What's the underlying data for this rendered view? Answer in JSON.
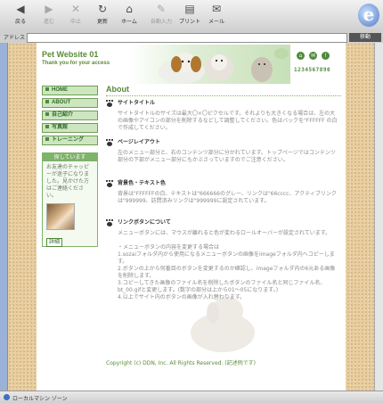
{
  "browser": {
    "toolbar": [
      {
        "label": "戻る",
        "icon": "back-icon",
        "enabled": true
      },
      {
        "label": "進む",
        "icon": "forward-icon",
        "enabled": false
      },
      {
        "label": "中止",
        "icon": "stop-icon",
        "enabled": false
      },
      {
        "label": "更新",
        "icon": "refresh-icon",
        "enabled": true
      },
      {
        "label": "ホーム",
        "icon": "home-icon",
        "enabled": true
      },
      {
        "label": "自動入力",
        "icon": "autofill-icon",
        "enabled": false
      },
      {
        "label": "プリント",
        "icon": "print-icon",
        "enabled": true
      },
      {
        "label": "メール",
        "icon": "mail-icon",
        "enabled": true
      }
    ],
    "address_label": "アドレス",
    "address_value": "",
    "go_label": "移動",
    "status_text": "ローカルマシン ゾーン"
  },
  "site": {
    "title": "Pet Website 01",
    "subtitle": "Thank you for your access",
    "counter": "1234567890"
  },
  "nav": [
    "HOME",
    "ABOUT",
    "自己紹介",
    "写真館",
    "トレーニング"
  ],
  "sidebar_box": {
    "heading": "探しています",
    "text": "お友達のチャッピーが迷子になりました。見かけた方はご連絡ください。",
    "button": "詳細"
  },
  "main": {
    "title": "About",
    "sections": [
      {
        "heading": "サイトタイトル",
        "body": "サイトタイトルのサイズは最大〇×〇ピクセルです。それよりも大きくなる場合は、左の大の画像やアイコンの部分を削除するなどして調整してください。色はバックを\"FFFFFF の白で作成してください。"
      },
      {
        "heading": "ページレイアウト",
        "body": "左のメニュー部分と、右のコンテンツ部分に分かれています。トップページではコンテンツ部分の下部がメニュー部分にもかぶさっていますのでご注意ください。"
      },
      {
        "heading": "背景色・テキスト色",
        "body": "背景は\"FFFFFFの白、テキストは\"666666のグレー、リンクは\"66cccc、アクティブリンクは\"999999、訪問済みリンクは\"999999に設定されています。"
      },
      {
        "heading": "リンクボタンについて",
        "body": "メニューボタンには、マウスが離れると色が変わるロールオーバーが設定されています。\n\n・メニューボタンの内容を変更する場合は\n1.sozaiフォルダ内から使用になるメニューボタンの画像をimageフォルダ内へコピーします。\n2.ボタンの上から何番目のボタンを変更するのか確認し、imageフォルダ内の6元ある画像を削除します。\n3.コピーしてきた画像のファイル名を削除したボタンのファイル名と同じファイル名、bt_00.gifと変更します。(数字の部分は上から01～05になります。)\n4.以上でサイト内のボタンの画像が入れ替わります。"
      }
    ],
    "footer": "Copyright (c) DDN, Inc. All Rights Reserved. (記述例です)"
  },
  "colors": {
    "accent": "#5a8a3a",
    "nav_bg": "#cde6bf",
    "background": "#e8cfa2"
  }
}
